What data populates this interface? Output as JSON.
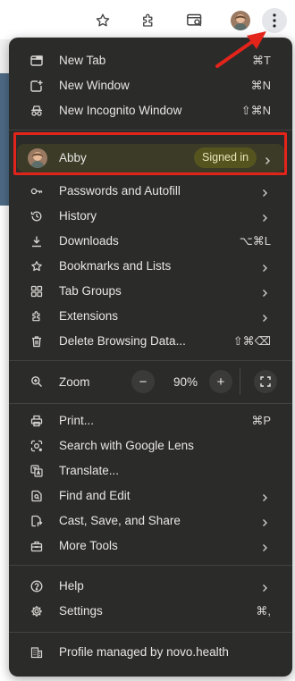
{
  "toolbar": {
    "buttons": [
      "star-icon",
      "extensions-icon",
      "search-tabs-icon",
      "profile-avatar",
      "more-menu-icon"
    ]
  },
  "colors": {
    "menu_bg": "#2b2b2a",
    "highlight": "#e3241b",
    "signed_in_badge": "#55541f"
  },
  "menu": {
    "new_tab": {
      "label": "New Tab",
      "shortcut": "⌘T"
    },
    "new_window": {
      "label": "New Window",
      "shortcut": "⌘N"
    },
    "incognito": {
      "label": "New Incognito Window",
      "shortcut": "⇧⌘N"
    },
    "profile": {
      "name": "Abby",
      "status": "Signed in"
    },
    "passwords": {
      "label": "Passwords and Autofill"
    },
    "history": {
      "label": "History"
    },
    "downloads": {
      "label": "Downloads",
      "shortcut": "⌥⌘L"
    },
    "bookmarks": {
      "label": "Bookmarks and Lists"
    },
    "tab_groups": {
      "label": "Tab Groups"
    },
    "extensions": {
      "label": "Extensions"
    },
    "delete_data": {
      "label": "Delete Browsing Data...",
      "shortcut": "⇧⌘⌫"
    },
    "zoom": {
      "label": "Zoom",
      "value": "90%",
      "minus": "−",
      "plus": "+"
    },
    "print": {
      "label": "Print...",
      "shortcut": "⌘P"
    },
    "lens": {
      "label": "Search with Google Lens"
    },
    "translate": {
      "label": "Translate..."
    },
    "find_edit": {
      "label": "Find and Edit"
    },
    "cast": {
      "label": "Cast, Save, and Share"
    },
    "more_tools": {
      "label": "More Tools"
    },
    "help": {
      "label": "Help"
    },
    "settings": {
      "label": "Settings",
      "shortcut": "⌘,"
    },
    "managed": {
      "label": "Profile managed by novo.health"
    }
  }
}
